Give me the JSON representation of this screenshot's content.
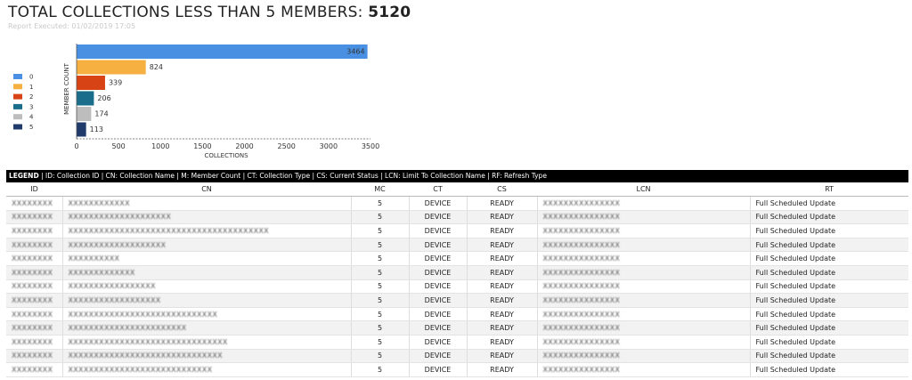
{
  "report": {
    "title_prefix": "TOTAL COLLECTIONS LESS THAN 5 MEMBERS:",
    "title_count": "5120",
    "executed": "Report Executed: 01/02/2019 17:05"
  },
  "chart_data": {
    "type": "bar",
    "orientation": "horizontal",
    "categories": [
      "0",
      "1",
      "2",
      "3",
      "4",
      "5"
    ],
    "values": [
      3464,
      824,
      339,
      206,
      174,
      113
    ],
    "colors": [
      "#4a90e2",
      "#f5b041",
      "#d84315",
      "#1a6e8c",
      "#bdbdbd",
      "#1f3a6b"
    ],
    "xlabel": "COLLECTIONS",
    "ylabel": "MEMBER COUNT",
    "xlim": [
      0,
      3500
    ],
    "xticks": [
      "0",
      "500",
      "1000",
      "1500",
      "2000",
      "2500",
      "3000",
      "3500"
    ],
    "legend": [
      "0",
      "1",
      "2",
      "3",
      "4",
      "5"
    ],
    "legend_position": "left",
    "grid": false
  },
  "legend_line": {
    "label": "LEGEND",
    "text": " | ID: Collection ID | CN: Collection Name | M: Member Count | CT: Collection Type | CS: Current Status | LCN: Limit To Collection Name | RF: Refresh Type"
  },
  "table": {
    "columns": [
      "ID",
      "CN",
      "MC",
      "CT",
      "CS",
      "LCN",
      "RT"
    ],
    "rows": [
      {
        "id": "XXXXXXXX",
        "cn": "XXXXXXXXXXXX",
        "mc": "5",
        "ct": "DEVICE",
        "cs": "READY",
        "lcn": "XXXXXXXXXXXXXXX",
        "rt": "Full Scheduled Update"
      },
      {
        "id": "XXXXXXXX",
        "cn": "XXXXXXXXXXXXXXXXXXXX",
        "mc": "5",
        "ct": "DEVICE",
        "cs": "READY",
        "lcn": "XXXXXXXXXXXXXXX",
        "rt": "Full Scheduled Update"
      },
      {
        "id": "XXXXXXXX",
        "cn": "XXXXXXXXXXXXXXXXXXXXXXXXXXXXXXXXXXXXXXX",
        "mc": "5",
        "ct": "DEVICE",
        "cs": "READY",
        "lcn": "XXXXXXXXXXXXXXX",
        "rt": "Full Scheduled Update"
      },
      {
        "id": "XXXXXXXX",
        "cn": "XXXXXXXXXXXXXXXXXXX",
        "mc": "5",
        "ct": "DEVICE",
        "cs": "READY",
        "lcn": "XXXXXXXXXXXXXXX",
        "rt": "Full Scheduled Update"
      },
      {
        "id": "XXXXXXXX",
        "cn": "XXXXXXXXXX",
        "mc": "5",
        "ct": "DEVICE",
        "cs": "READY",
        "lcn": "XXXXXXXXXXXXXXX",
        "rt": "Full Scheduled Update"
      },
      {
        "id": "XXXXXXXX",
        "cn": "XXXXXXXXXXXXX",
        "mc": "5",
        "ct": "DEVICE",
        "cs": "READY",
        "lcn": "XXXXXXXXXXXXXXX",
        "rt": "Full Scheduled Update"
      },
      {
        "id": "XXXXXXXX",
        "cn": "XXXXXXXXXXXXXXXXX",
        "mc": "5",
        "ct": "DEVICE",
        "cs": "READY",
        "lcn": "XXXXXXXXXXXXXXX",
        "rt": "Full Scheduled Update"
      },
      {
        "id": "XXXXXXXX",
        "cn": "XXXXXXXXXXXXXXXXXX",
        "mc": "5",
        "ct": "DEVICE",
        "cs": "READY",
        "lcn": "XXXXXXXXXXXXXXX",
        "rt": "Full Scheduled Update"
      },
      {
        "id": "XXXXXXXX",
        "cn": "XXXXXXXXXXXXXXXXXXXXXXXXXXXXX",
        "mc": "5",
        "ct": "DEVICE",
        "cs": "READY",
        "lcn": "XXXXXXXXXXXXXXX",
        "rt": "Full Scheduled Update"
      },
      {
        "id": "XXXXXXXX",
        "cn": "XXXXXXXXXXXXXXXXXXXXXXX",
        "mc": "5",
        "ct": "DEVICE",
        "cs": "READY",
        "lcn": "XXXXXXXXXXXXXXX",
        "rt": "Full Scheduled Update"
      },
      {
        "id": "XXXXXXXX",
        "cn": "XXXXXXXXXXXXXXXXXXXXXXXXXXXXXXX",
        "mc": "5",
        "ct": "DEVICE",
        "cs": "READY",
        "lcn": "XXXXXXXXXXXXXXX",
        "rt": "Full Scheduled Update"
      },
      {
        "id": "XXXXXXXX",
        "cn": "XXXXXXXXXXXXXXXXXXXXXXXXXXXXXX",
        "mc": "5",
        "ct": "DEVICE",
        "cs": "READY",
        "lcn": "XXXXXXXXXXXXXXX",
        "rt": "Full Scheduled Update"
      },
      {
        "id": "XXXXXXXX",
        "cn": "XXXXXXXXXXXXXXXXXXXXXXXXXXXX",
        "mc": "5",
        "ct": "DEVICE",
        "cs": "READY",
        "lcn": "XXXXXXXXXXXXXXX",
        "rt": "Full Scheduled Update"
      }
    ]
  }
}
